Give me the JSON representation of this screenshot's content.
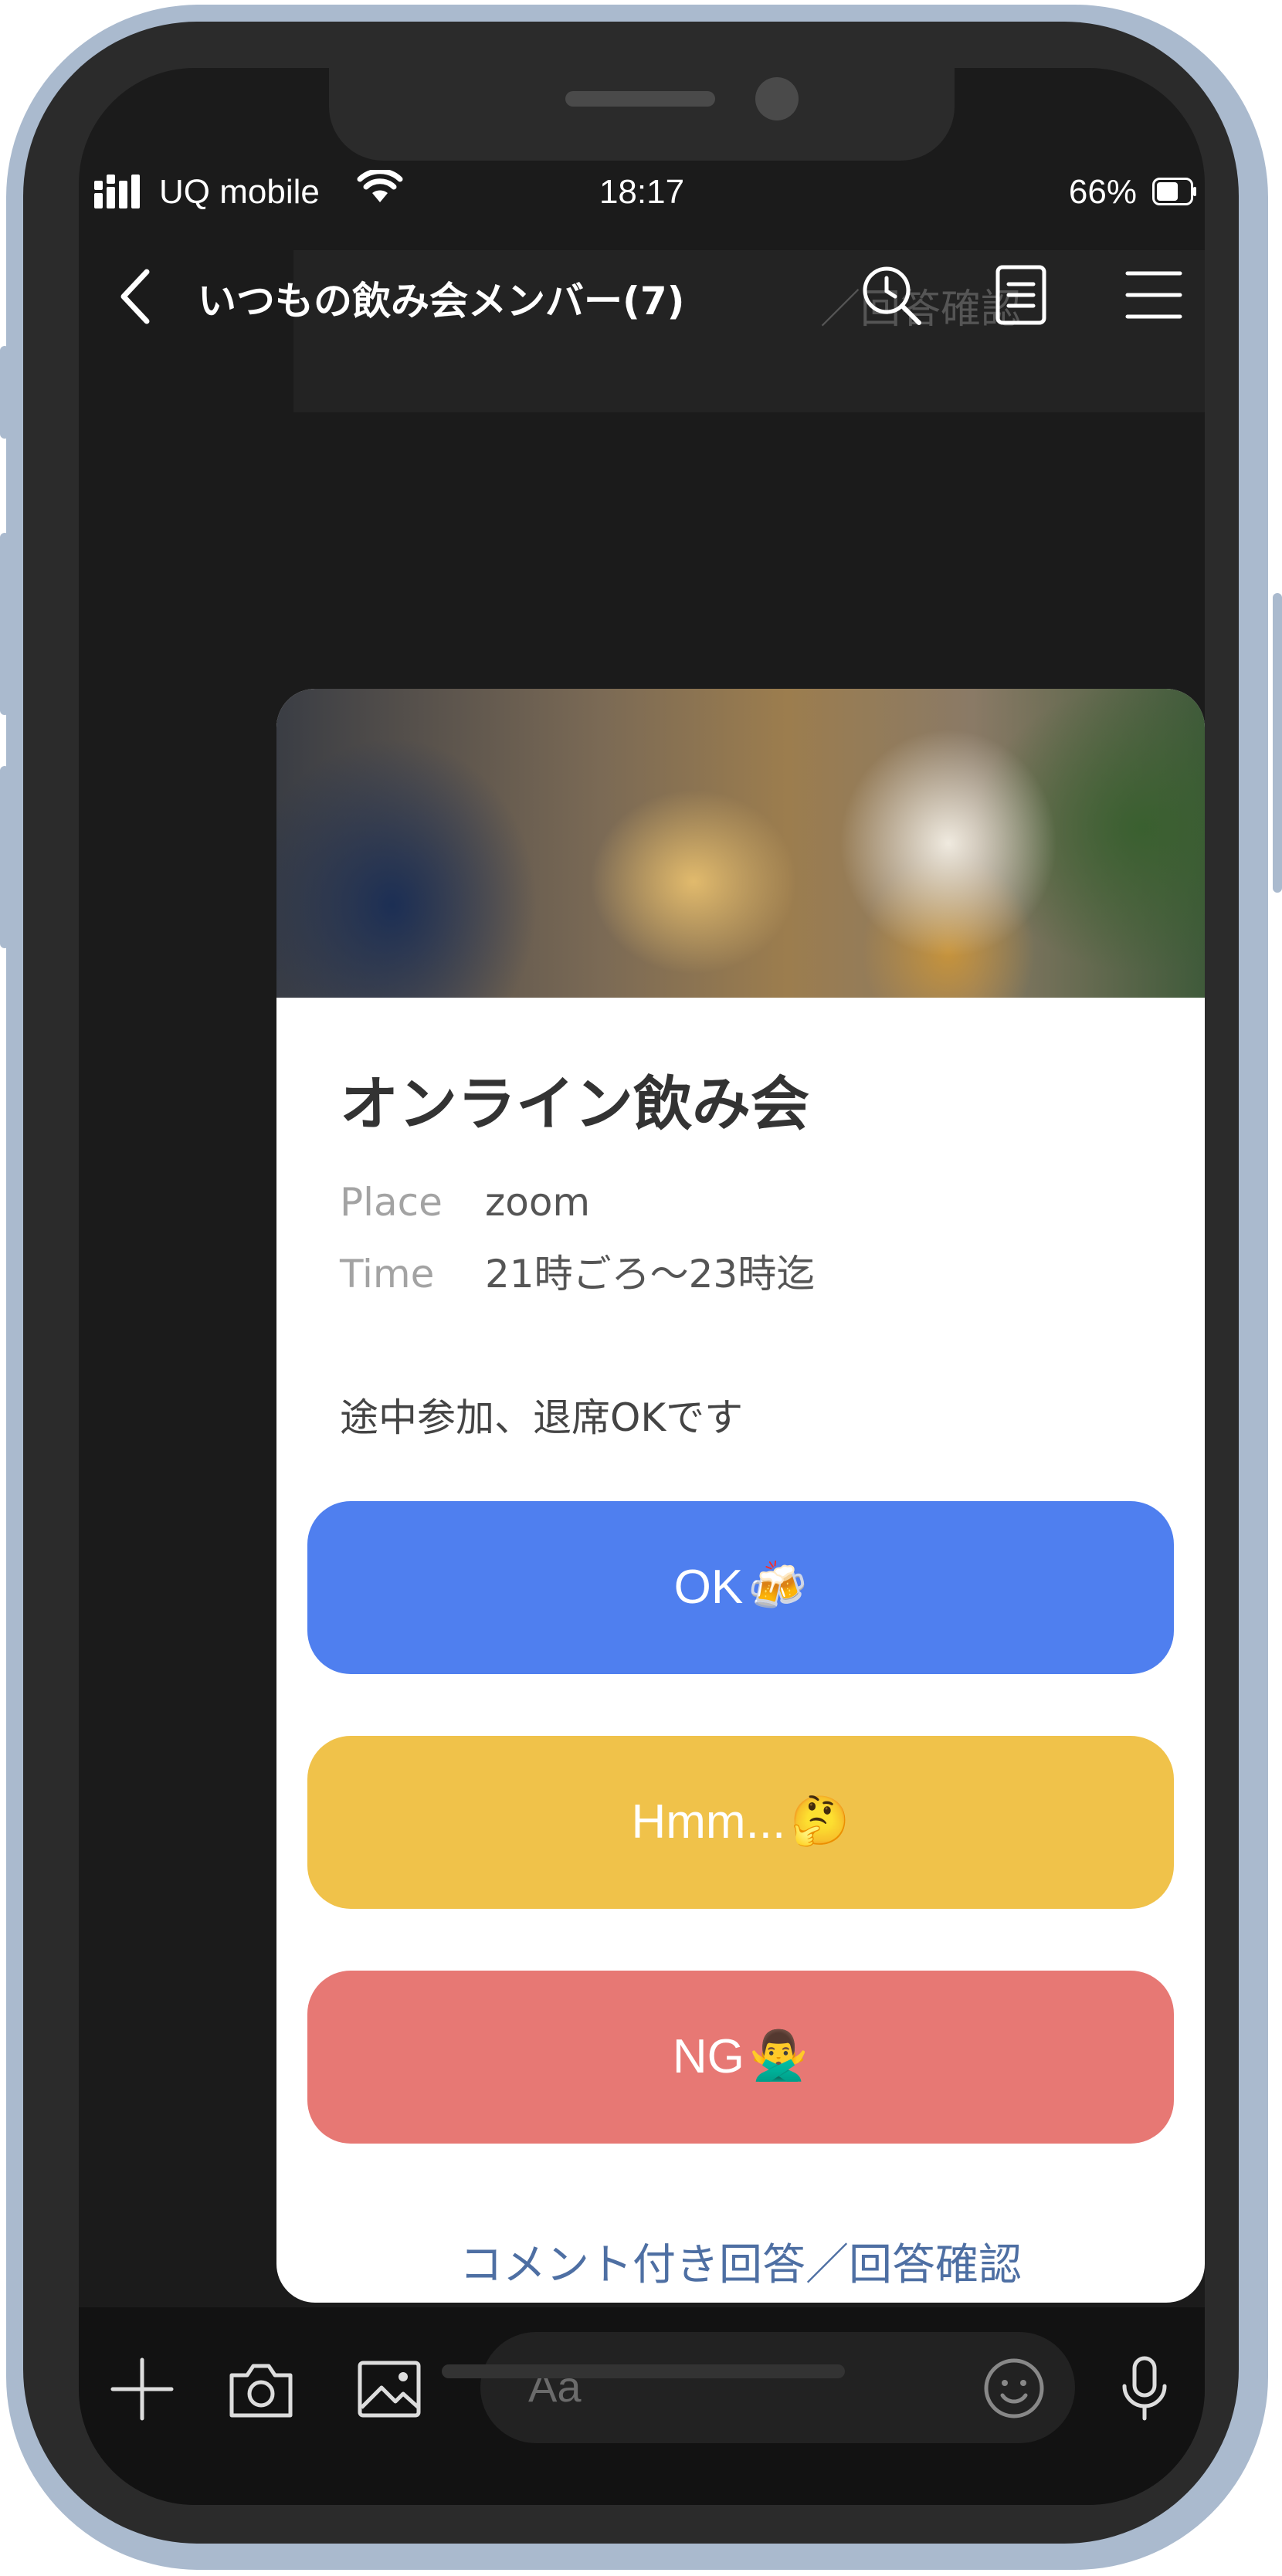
{
  "status_bar": {
    "carrier": "UQ mobile",
    "time": "18:17",
    "battery_percent": "66%",
    "battery_level": 0.66
  },
  "chat_header": {
    "title": "いつもの飲み会メンバー(7)",
    "background_ghost_text": "／回答確認",
    "icons": [
      "back-icon",
      "search-clock-icon",
      "notes-icon",
      "menu-icon"
    ]
  },
  "message_card": {
    "title": "オンライン飲み会",
    "details": [
      {
        "label": "Place",
        "value": "zoom"
      },
      {
        "label": "Time",
        "value": "21時ごろ〜23時迄"
      }
    ],
    "note": "途中参加、退席OKです",
    "buttons": [
      {
        "label": "OK",
        "emoji": "🍻",
        "color": "#4f7fef"
      },
      {
        "label": "Hmm...",
        "emoji": "🤔",
        "color": "#f0c24a"
      },
      {
        "label": "NG",
        "emoji": "🙅‍♂️",
        "color": "#e77874"
      }
    ],
    "comment_link": "コメント付き回答／回答確認"
  },
  "input_bar": {
    "placeholder": "Aa",
    "icons": [
      "plus-icon",
      "camera-icon",
      "image-icon",
      "emoji-icon",
      "microphone-icon"
    ]
  }
}
